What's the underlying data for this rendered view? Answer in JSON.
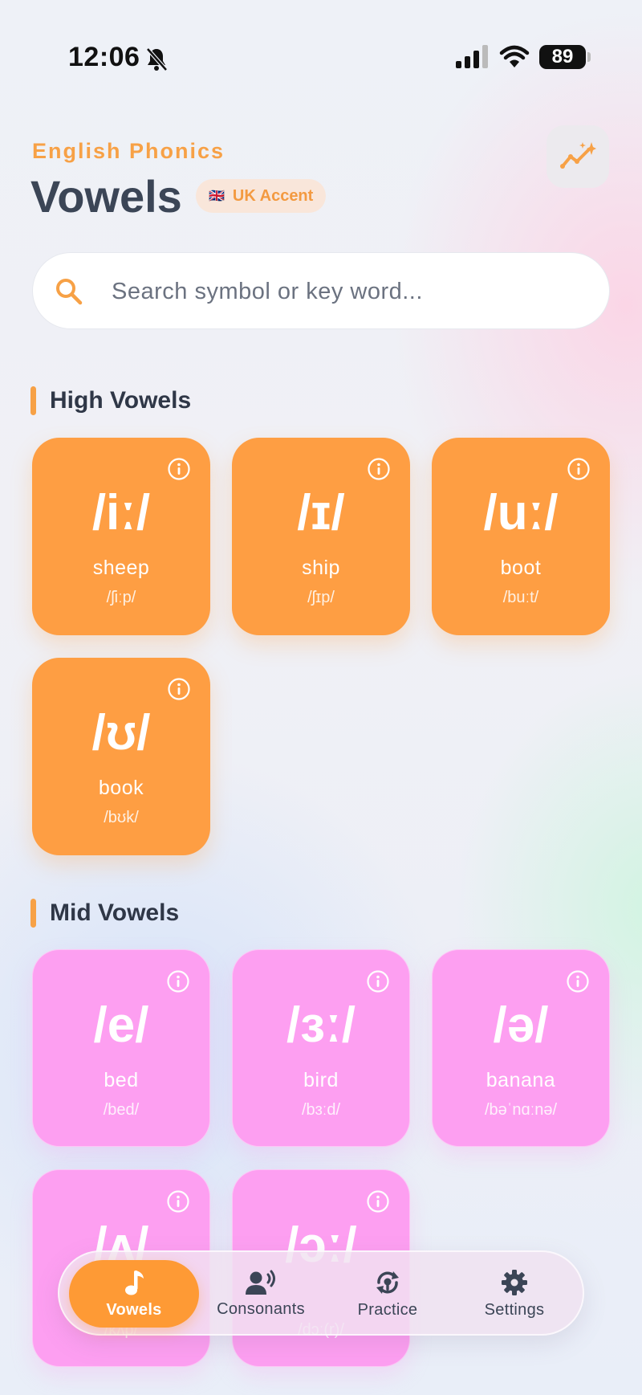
{
  "status_bar": {
    "time": "12:06",
    "battery": "89"
  },
  "header": {
    "eyebrow": "English Phonics",
    "title": "Vowels",
    "accent_flag": "🇬🇧",
    "accent_label": "UK Accent"
  },
  "search": {
    "placeholder": "Search symbol or key word..."
  },
  "sections": [
    {
      "title": "High Vowels",
      "color": "#fe9e43",
      "cards": [
        {
          "symbol": "/iː/",
          "word": "sheep",
          "ipa": "/ʃiːp/"
        },
        {
          "symbol": "/ɪ/",
          "word": "ship",
          "ipa": "/ʃɪp/"
        },
        {
          "symbol": "/uː/",
          "word": "boot",
          "ipa": "/buːt/"
        },
        {
          "symbol": "/ʊ/",
          "word": "book",
          "ipa": "/bʊk/"
        }
      ]
    },
    {
      "title": "Mid Vowels",
      "color": "#fd9ff1",
      "cards": [
        {
          "symbol": "/e/",
          "word": "bed",
          "ipa": "/bed/"
        },
        {
          "symbol": "/ɜː/",
          "word": "bird",
          "ipa": "/bɜːd/"
        },
        {
          "symbol": "/ə/",
          "word": "banana",
          "ipa": "/bəˈnɑːnə/"
        },
        {
          "symbol": "/ʌ/",
          "word": "",
          "ipa": "/kʌp/"
        },
        {
          "symbol": "/ɔː/",
          "word": "",
          "ipa": "/dɔː(r)/"
        }
      ]
    }
  ],
  "bottom_nav": [
    {
      "label": "Vowels",
      "icon": "music-note-icon",
      "active": true
    },
    {
      "label": "Consonants",
      "icon": "speaking-person-icon",
      "active": false
    },
    {
      "label": "Practice",
      "icon": "practice-cycle-icon",
      "active": false
    },
    {
      "label": "Settings",
      "icon": "gear-icon",
      "active": false
    }
  ],
  "colors": {
    "accent": "#f7a146",
    "orange_card": "#fe9e43",
    "pink_card": "#fd9ff1",
    "title": "#3b4556"
  }
}
